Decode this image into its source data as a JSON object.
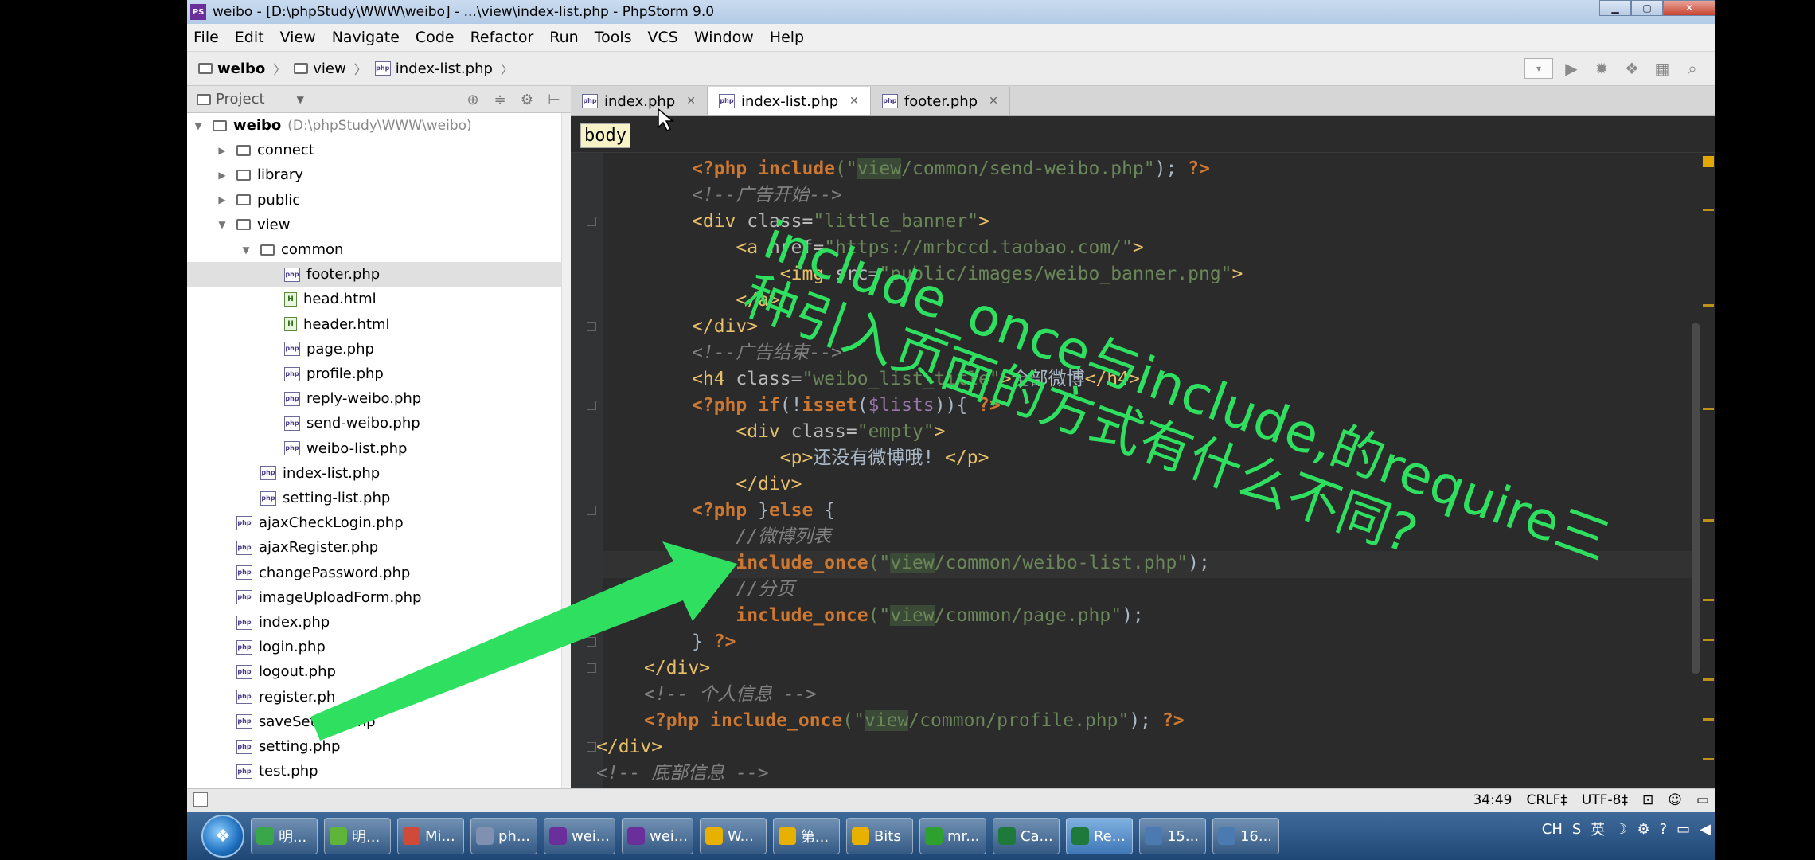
{
  "window": {
    "title": "weibo - [D:\\phpStudy\\WWW\\weibo] - ...\\view\\index-list.php - PhpStorm 9.0",
    "app_icon": "php-ic"
  },
  "menu": [
    "File",
    "Edit",
    "View",
    "Navigate",
    "Code",
    "Refactor",
    "Run",
    "Tools",
    "VCS",
    "Window",
    "Help"
  ],
  "breadcrumb": [
    {
      "label": "weibo",
      "icon": "folder-icon"
    },
    {
      "label": "view",
      "icon": "folder-icon"
    },
    {
      "label": "index-list.php",
      "icon": "php-file-icon"
    }
  ],
  "project_panel": {
    "title": "Project",
    "root": {
      "label": "weibo",
      "path": "(D:\\phpStudy\\WWW\\weibo)"
    },
    "items": [
      {
        "label": "connect",
        "type": "folder",
        "depth": 1,
        "state": "collapsed"
      },
      {
        "label": "library",
        "type": "folder",
        "depth": 1,
        "state": "collapsed"
      },
      {
        "label": "public",
        "type": "folder",
        "depth": 1,
        "state": "collapsed"
      },
      {
        "label": "view",
        "type": "folder",
        "depth": 1,
        "state": "expanded"
      },
      {
        "label": "common",
        "type": "folder",
        "depth": 2,
        "state": "expanded"
      },
      {
        "label": "footer.php",
        "type": "php",
        "depth": 3,
        "selected": true
      },
      {
        "label": "head.html",
        "type": "html",
        "depth": 3
      },
      {
        "label": "header.html",
        "type": "html",
        "depth": 3
      },
      {
        "label": "page.php",
        "type": "php",
        "depth": 3
      },
      {
        "label": "profile.php",
        "type": "php",
        "depth": 3
      },
      {
        "label": "reply-weibo.php",
        "type": "php",
        "depth": 3
      },
      {
        "label": "send-weibo.php",
        "type": "php",
        "depth": 3
      },
      {
        "label": "weibo-list.php",
        "type": "php",
        "depth": 3
      },
      {
        "label": "index-list.php",
        "type": "php",
        "depth": 2
      },
      {
        "label": "setting-list.php",
        "type": "php",
        "depth": 2
      },
      {
        "label": "ajaxCheckLogin.php",
        "type": "php",
        "depth": 1
      },
      {
        "label": "ajaxRegister.php",
        "type": "php",
        "depth": 1
      },
      {
        "label": "changePassword.php",
        "type": "php",
        "depth": 1
      },
      {
        "label": "imageUploadForm.php",
        "type": "php",
        "depth": 1
      },
      {
        "label": "index.php",
        "type": "php",
        "depth": 1
      },
      {
        "label": "login.php",
        "type": "php",
        "depth": 1
      },
      {
        "label": "logout.php",
        "type": "php",
        "depth": 1
      },
      {
        "label": "register.ph",
        "type": "php",
        "depth": 1
      },
      {
        "label": "saveSetting.php",
        "type": "php",
        "depth": 1
      },
      {
        "label": "setting.php",
        "type": "php",
        "depth": 1
      },
      {
        "label": "test.php",
        "type": "php",
        "depth": 1
      }
    ]
  },
  "tabs": [
    {
      "label": "index.php",
      "active": false
    },
    {
      "label": "index-list.php",
      "active": true
    },
    {
      "label": "footer.php",
      "active": false
    }
  ],
  "editor": {
    "breadcrumb_tag": "body",
    "lines": [
      [
        {
          "t": "<?php ",
          "c": "kw"
        },
        {
          "t": "include",
          "c": "kw"
        },
        {
          "t": "(\"",
          "c": "str"
        },
        {
          "t": "view",
          "c": "strv"
        },
        {
          "t": "/common/send-weibo.php\"",
          "c": "str"
        },
        {
          "t": "); ",
          "c": ""
        },
        {
          "t": "?>",
          "c": "kw"
        }
      ],
      [
        {
          "t": "<!--广告开始-->",
          "c": "cm"
        }
      ],
      [
        {
          "t": "<div ",
          "c": "tag"
        },
        {
          "t": "class=",
          "c": "attr"
        },
        {
          "t": "\"little_banner\"",
          "c": "str"
        },
        {
          "t": ">",
          "c": "tag"
        }
      ],
      [
        {
          "t": "    <a ",
          "c": "tag"
        },
        {
          "t": "href=",
          "c": "attr"
        },
        {
          "t": "\"https://mrbccd.taobao.com/\"",
          "c": "str"
        },
        {
          "t": ">",
          "c": "tag"
        }
      ],
      [
        {
          "t": "        <img ",
          "c": "tag"
        },
        {
          "t": "src=",
          "c": "attr"
        },
        {
          "t": "\"public/images/weibo_banner.png\"",
          "c": "str"
        },
        {
          "t": ">",
          "c": "tag"
        }
      ],
      [
        {
          "t": "    </a>",
          "c": "tag"
        }
      ],
      [
        {
          "t": "</div>",
          "c": "tag"
        }
      ],
      [
        {
          "t": "<!--广告结束-->",
          "c": "cm"
        }
      ],
      [
        {
          "t": "<h4 ",
          "c": "tag"
        },
        {
          "t": "class=",
          "c": "attr"
        },
        {
          "t": "\"weibo_list_title\"",
          "c": "str"
        },
        {
          "t": ">",
          "c": "tag"
        },
        {
          "t": "全部微博",
          "c": ""
        },
        {
          "t": "</h4>",
          "c": "tag"
        }
      ],
      [
        {
          "t": "<?php ",
          "c": "kw"
        },
        {
          "t": "if",
          "c": "kw"
        },
        {
          "t": "(!",
          "c": ""
        },
        {
          "t": "isset",
          "c": "kw"
        },
        {
          "t": "(",
          "c": ""
        },
        {
          "t": "$lists",
          "c": "var"
        },
        {
          "t": ")){ ",
          "c": ""
        },
        {
          "t": "?>",
          "c": "kw"
        }
      ],
      [
        {
          "t": "    <div ",
          "c": "tag"
        },
        {
          "t": "class=",
          "c": "attr"
        },
        {
          "t": "\"empty\"",
          "c": "str"
        },
        {
          "t": ">",
          "c": "tag"
        }
      ],
      [
        {
          "t": "        <p>",
          "c": "tag"
        },
        {
          "t": "还没有微博哦! ",
          "c": ""
        },
        {
          "t": "</p>",
          "c": "tag"
        }
      ],
      [
        {
          "t": "    </div>",
          "c": "tag"
        }
      ],
      [
        {
          "t": "<?php ",
          "c": "kw"
        },
        {
          "t": "}",
          "c": ""
        },
        {
          "t": "else ",
          "c": "kw"
        },
        {
          "t": "{",
          "c": ""
        }
      ],
      [
        {
          "t": "    //微博列表",
          "c": "cm"
        }
      ],
      [
        {
          "t": "    include_once",
          "c": "kw"
        },
        {
          "t": "(\"",
          "c": "str"
        },
        {
          "t": "view",
          "c": "strv"
        },
        {
          "t": "/common/weibo-list.php\"",
          "c": "str"
        },
        {
          "t": ");",
          "c": ""
        }
      ],
      [
        {
          "t": "    //分页",
          "c": "cm"
        }
      ],
      [
        {
          "t": "    include_once",
          "c": "kw"
        },
        {
          "t": "(\"",
          "c": "str"
        },
        {
          "t": "view",
          "c": "strv"
        },
        {
          "t": "/common/page.php\"",
          "c": "str"
        },
        {
          "t": ");",
          "c": ""
        }
      ],
      [
        {
          "t": "} ",
          "c": ""
        },
        {
          "t": "?>",
          "c": "kw"
        }
      ],
      [
        {
          "t": "</div>",
          "c": "tag"
        }
      ],
      [
        {
          "t": "<!-- 个人信息 -->",
          "c": "cm"
        }
      ],
      [
        {
          "t": "<?php ",
          "c": "kw"
        },
        {
          "t": "include_once",
          "c": "kw"
        },
        {
          "t": "(\"",
          "c": "str"
        },
        {
          "t": "view",
          "c": "strv"
        },
        {
          "t": "/common/profile.php\"",
          "c": "str"
        },
        {
          "t": "); ",
          "c": ""
        },
        {
          "t": "?>",
          "c": "kw"
        }
      ],
      [
        {
          "t": "</div>",
          "c": "tag"
        }
      ],
      [
        {
          "t": "<!-- 底部信息 -->",
          "c": "cm"
        }
      ]
    ]
  },
  "status": {
    "position": "34:49",
    "line_ending": "CRLF‡",
    "encoding": "UTF-8‡"
  },
  "taskbar": [
    {
      "label": "明...",
      "color": "#3aa64a",
      "icon": "browser-icon"
    },
    {
      "label": "明...",
      "color": "#5fb43a",
      "icon": "360-icon"
    },
    {
      "label": "Mi...",
      "color": "#d04a3a",
      "icon": "mindmap-icon"
    },
    {
      "label": "ph...",
      "color": "#8090b0",
      "icon": "phpstudy-icon"
    },
    {
      "label": "wei...",
      "color": "#6a2f9a",
      "icon": "phpstorm-icon"
    },
    {
      "label": "wei...",
      "color": "#6a2f9a",
      "icon": "phpstorm-icon"
    },
    {
      "label": "W...",
      "color": "#e8b000",
      "icon": "folder-icon"
    },
    {
      "label": "第...",
      "color": "#e8b000",
      "icon": "folder-icon"
    },
    {
      "label": "Bits",
      "color": "#e8b000",
      "icon": "folder-icon"
    },
    {
      "label": "mr...",
      "color": "#2ea02e",
      "icon": "melon-icon"
    },
    {
      "label": "Ca...",
      "color": "#1d7a3a",
      "icon": "camtasia-icon"
    },
    {
      "label": "Re...",
      "color": "#1d7a3a",
      "icon": "recorder-icon",
      "active": true
    },
    {
      "label": "15...",
      "color": "#4a7ab0",
      "icon": "window-icon"
    },
    {
      "label": "16...",
      "color": "#4a7ab0",
      "icon": "window-icon"
    }
  ],
  "tray": {
    "lang": "CH",
    "ime": "英"
  },
  "annotation": {
    "line1": "include_once与include,的require三",
    "line2": "种引入页面的方式有什么不同?",
    "color": "#2fe060"
  }
}
